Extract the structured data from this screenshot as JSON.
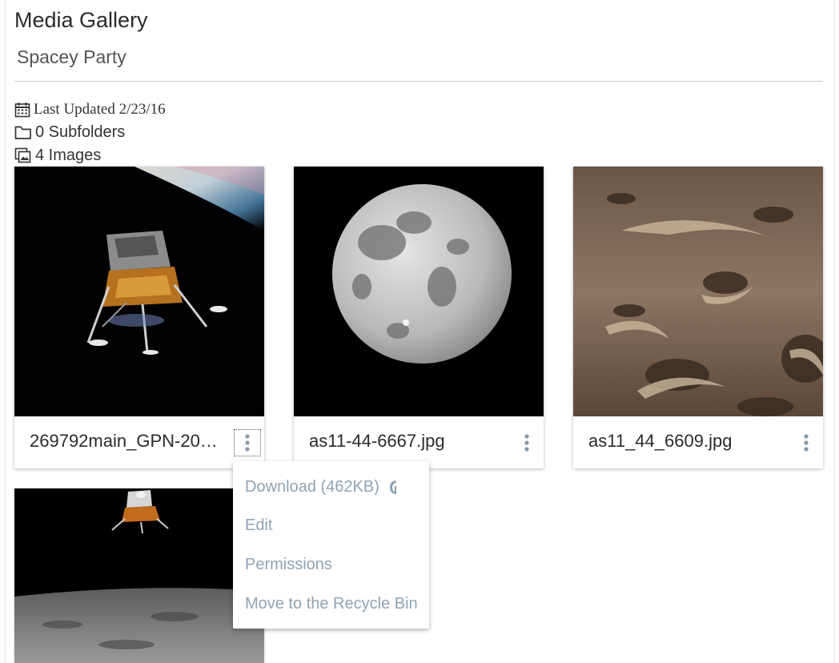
{
  "header": {
    "title": "Media Gallery",
    "subtitle": "Spacey Party"
  },
  "meta": {
    "last_updated": "Last Updated 2/23/16",
    "subfolders": "0 Subfolders",
    "images": "4 Images"
  },
  "cards": [
    {
      "filename": "269792main_GPN-20…",
      "thumbnail": "lunar-module-over-earth"
    },
    {
      "filename": "as11-44-6667.jpg",
      "thumbnail": "full-moon"
    },
    {
      "filename": "as11_44_6609.jpg",
      "thumbnail": "cratered-lunar-surface"
    },
    {
      "filename": "",
      "thumbnail": "lunar-module-over-moon-horizon"
    }
  ],
  "context_menu": {
    "items": [
      {
        "label": "Download (462KB)",
        "icon": "download-cursor-icon"
      },
      {
        "label": "Edit"
      },
      {
        "label": "Permissions"
      },
      {
        "label": "Move to the Recycle Bin"
      }
    ]
  },
  "colors": {
    "menu_text": "#8fa3b3",
    "kebab": "#8a9aa8",
    "rule": "#c9c9c9"
  }
}
